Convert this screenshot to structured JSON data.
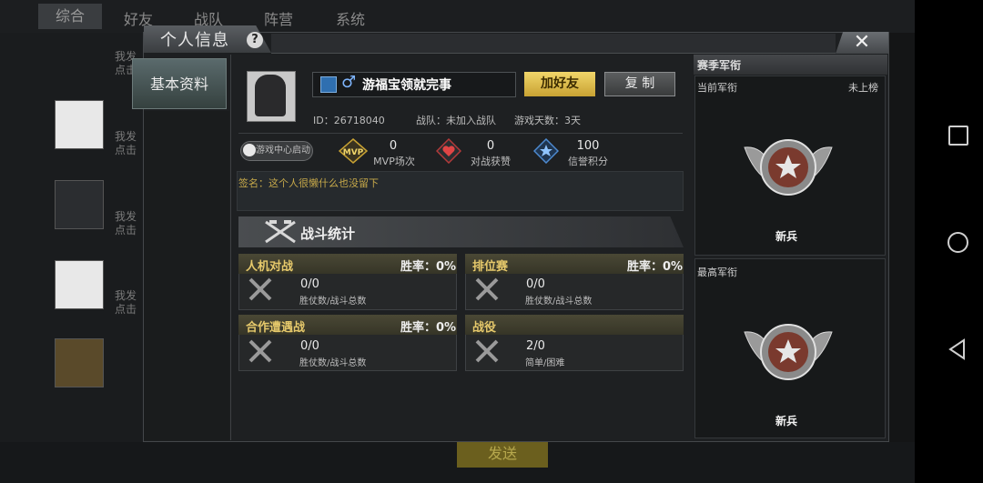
{
  "background": {
    "tabs": [
      "综合",
      "好友",
      "战队",
      "阵营",
      "系统"
    ],
    "chat_text": [
      "我发",
      "点击",
      "我发",
      "点击",
      "我发",
      "点击",
      "我发",
      "点击"
    ],
    "send_label": "发送"
  },
  "dialog": {
    "title": "个人信息",
    "help_icon": "?",
    "close_icon": "✕",
    "side_tab": "基本资料"
  },
  "profile": {
    "name": "游福宝领就完事",
    "gender_icon": "♂",
    "add_friend_label": "加好友",
    "copy_label": "复 制",
    "id_text": "ID：26718040",
    "team_text": "战队：未加入战队",
    "days_text": "游戏天数：3天",
    "game_center_label": "游戏中心启动",
    "stats": [
      {
        "icon": "mvp-icon",
        "value": "0",
        "label": "MVP场次"
      },
      {
        "icon": "heart-icon",
        "value": "0",
        "label": "对战获赞"
      },
      {
        "icon": "star-icon",
        "value": "100",
        "label": "信誉积分"
      }
    ],
    "signature": "签名：这个人很懒什么也没留下"
  },
  "battle_stats": {
    "title": "战斗统计",
    "cards": [
      {
        "title": "人机对战",
        "rate": "胜率：0%",
        "value": "0/0",
        "label": "胜仗数/战斗总数"
      },
      {
        "title": "排位赛",
        "rate": "胜率：0%",
        "value": "0/0",
        "label": "胜仗数/战斗总数"
      },
      {
        "title": "合作遭遇战",
        "rate": "胜率：0%",
        "value": "0/0",
        "label": "胜仗数/战斗总数"
      },
      {
        "title": "战役",
        "rate": "",
        "value": "2/0",
        "label": "简单/困难"
      }
    ]
  },
  "season_rank": {
    "title": "赛季军衔",
    "current_label": "当前军衔",
    "current_status": "未上榜",
    "current_rank": "新兵",
    "highest_label": "最高军衔",
    "highest_rank": "新兵"
  },
  "colors": {
    "gold": "#c8a233",
    "accent_text": "#e6c96b",
    "panel": "#1e2022"
  }
}
